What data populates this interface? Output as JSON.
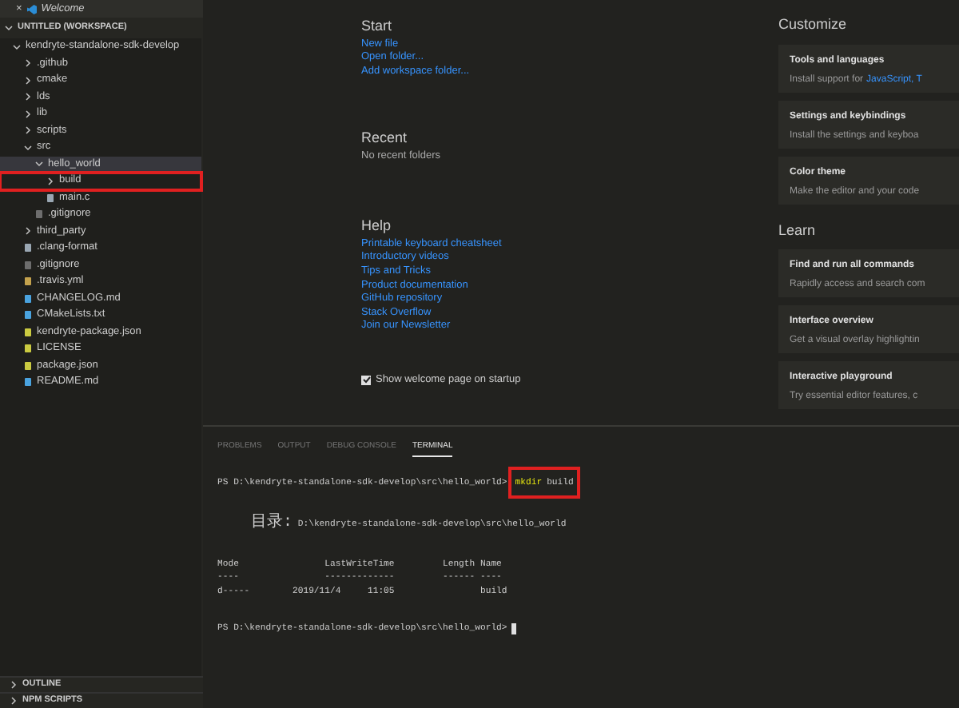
{
  "editor_tab": {
    "close": "×",
    "label": "Welcome"
  },
  "explorer": {
    "workspace": "UNTITLED (WORKSPACE)",
    "expanded": true,
    "tree": [
      {
        "label": "kendryte-standalone-sdk-develop",
        "kind": "folder",
        "expanded": true,
        "selected": false,
        "annotated": false,
        "children": [
          {
            "label": ".github",
            "kind": "folder",
            "expanded": false,
            "selected": false,
            "annotated": false
          },
          {
            "label": "cmake",
            "kind": "folder",
            "expanded": false,
            "selected": false,
            "annotated": false
          },
          {
            "label": "lds",
            "kind": "folder",
            "expanded": false,
            "selected": false,
            "annotated": false
          },
          {
            "label": "lib",
            "kind": "folder",
            "expanded": false,
            "selected": false,
            "annotated": false
          },
          {
            "label": "scripts",
            "kind": "folder",
            "expanded": false,
            "selected": false,
            "annotated": false
          },
          {
            "label": "src",
            "kind": "folder",
            "expanded": true,
            "selected": false,
            "annotated": false,
            "children": [
              {
                "label": "hello_world",
                "kind": "folder",
                "expanded": true,
                "selected": true,
                "annotated": false,
                "children": [
                  {
                    "label": "build",
                    "kind": "folder",
                    "expanded": false,
                    "selected": false,
                    "annotated": true
                  },
                  {
                    "label": "main.c",
                    "kind": "c",
                    "selected": false,
                    "annotated": false
                  }
                ]
              },
              {
                "label": ".gitignore",
                "kind": "git",
                "selected": false,
                "annotated": false
              }
            ]
          },
          {
            "label": "third_party",
            "kind": "folder",
            "expanded": false,
            "selected": false,
            "annotated": false
          },
          {
            "label": ".clang-format",
            "kind": "text",
            "selected": false,
            "annotated": false
          },
          {
            "label": ".gitignore",
            "kind": "git",
            "selected": false,
            "annotated": false
          },
          {
            "label": ".travis.yml",
            "kind": "yml",
            "selected": false,
            "annotated": false
          },
          {
            "label": "CHANGELOG.md",
            "kind": "info",
            "selected": false,
            "annotated": false
          },
          {
            "label": "CMakeLists.txt",
            "kind": "cmake",
            "selected": false,
            "annotated": false
          },
          {
            "label": "kendryte-package.json",
            "kind": "json",
            "selected": false,
            "annotated": false
          },
          {
            "label": "LICENSE",
            "kind": "license",
            "selected": false,
            "annotated": false
          },
          {
            "label": "package.json",
            "kind": "json",
            "selected": false,
            "annotated": false
          },
          {
            "label": "README.md",
            "kind": "info",
            "selected": false,
            "annotated": false
          }
        ]
      }
    ]
  },
  "bottom_sections": [
    {
      "label": "OUTLINE",
      "expanded": false
    },
    {
      "label": "NPM SCRIPTS",
      "expanded": false
    }
  ],
  "welcome": {
    "start": {
      "title": "Start",
      "links": [
        "New file",
        "Open folder...",
        "Add workspace folder..."
      ]
    },
    "recent": {
      "title": "Recent",
      "empty": "No recent folders"
    },
    "help": {
      "title": "Help",
      "links": [
        "Printable keyboard cheatsheet",
        "Introductory videos",
        "Tips and Tricks",
        "Product documentation",
        "GitHub repository",
        "Stack Overflow",
        "Join our Newsletter"
      ]
    },
    "show_on_startup": {
      "label": "Show welcome page on startup",
      "checked": true
    },
    "customize": {
      "title": "Customize",
      "cards": [
        {
          "title": "Tools and languages",
          "description": "Install support for",
          "link": "JavaScript, T"
        },
        {
          "title": "Settings and keybindings",
          "description": "Install the settings and keyboa"
        },
        {
          "title": "Color theme",
          "description": "Make the editor and your code"
        }
      ]
    },
    "learn": {
      "title": "Learn",
      "cards": [
        {
          "title": "Find and run all commands",
          "description": "Rapidly access and search com"
        },
        {
          "title": "Interface overview",
          "description": "Get a visual overlay highlightin"
        },
        {
          "title": "Interactive playground",
          "description": "Try essential editor features, c"
        }
      ]
    }
  },
  "panel": {
    "tabs": [
      {
        "label": "PROBLEMS",
        "selected": false
      },
      {
        "label": "OUTPUT",
        "selected": false
      },
      {
        "label": "DEBUG CONSOLE",
        "selected": false
      },
      {
        "label": "TERMINAL",
        "selected": true
      }
    ],
    "terminal": [
      {
        "kind": "command",
        "prompt": "PS D:\\kendryte-standalone-sdk-develop\\src\\hello_world>",
        "command": "mkdir",
        "args": "build",
        "annotated": true
      },
      {
        "kind": "directory",
        "label": "目录:",
        "path": "D:\\kendryte-standalone-sdk-develop\\src\\hello_world"
      },
      {
        "kind": "text",
        "text": "Mode                LastWriteTime         Length Name"
      },
      {
        "kind": "text",
        "text": "----                -------------         ------ ----"
      },
      {
        "kind": "text",
        "text": "d-----        2019/11/4     11:05                build"
      },
      {
        "kind": "prompt",
        "prompt": "PS D:\\kendryte-standalone-sdk-develop\\src\\hello_world>",
        "cursor": true
      }
    ]
  }
}
